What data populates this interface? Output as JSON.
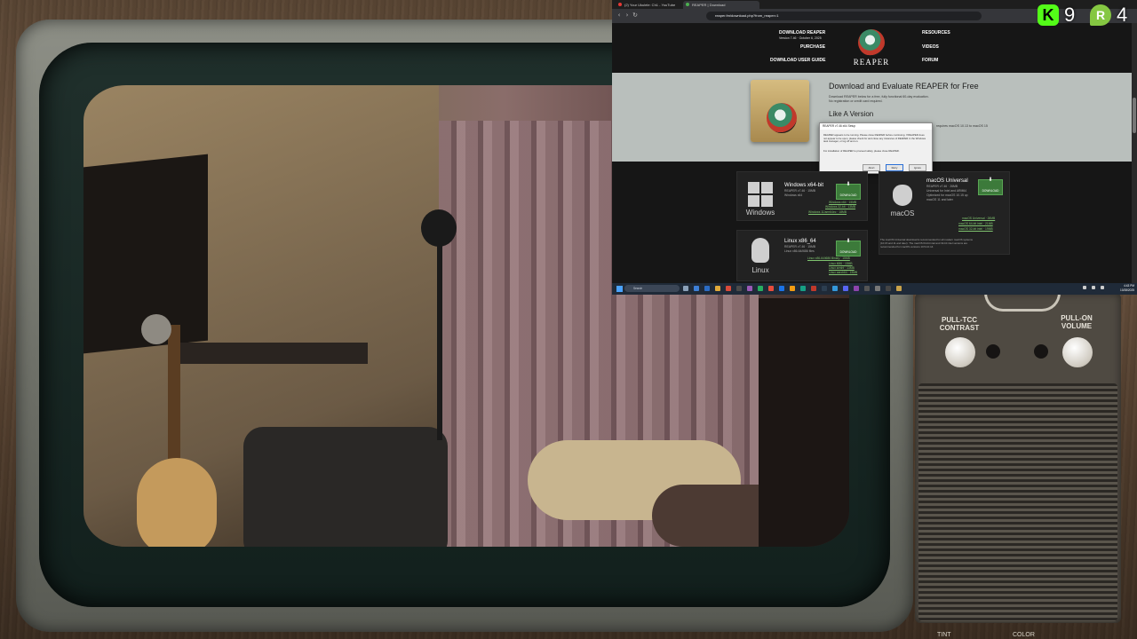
{
  "browser": {
    "tabs": [
      {
        "label": "(2) Your Ukulele: Ch1 - YouTube",
        "color": "#e53935"
      },
      {
        "label": "REAPER | Download",
        "color": "#4caf50"
      }
    ],
    "url": "reaper.fm/download.php?from_reaper=1"
  },
  "site": {
    "nav_left": {
      "download": "DOWNLOAD REAPER",
      "version": "Version 7.46 · October 6, 2025",
      "purchase": "PURCHASE",
      "user_guide": "DOWNLOAD USER GUIDE"
    },
    "logo_text": "REAPER",
    "nav_right": {
      "resources": "RESOURCES",
      "videos": "VIDEOS",
      "forum": "FORUM"
    },
    "hero": {
      "title": "Download and Evaluate REAPER for Free",
      "line1": "Download REAPER below for a free, fully functional 60-day evaluation.",
      "line2": "No registration or credit card required.",
      "subtitle": "Like A Version",
      "note": "requires macOS 10.13 to macOS 15"
    },
    "dialog": {
      "title": "REAPER v7.46 x64 Setup",
      "text1": "REAPER appears to be running. Please close REAPER before continuing. If REAPER does not appear to be open, please check for and close any instances of REAPER in the Windows task manager, or log off and on.",
      "text2": "For installation of REAPER to proceed safely, please close REAPER.",
      "btn_abort": "Abort",
      "btn_retry": "Retry",
      "btn_ignore": "Ignore"
    },
    "downloads": {
      "button_label": "DOWNLOAD",
      "windows": {
        "name": "Windows",
        "title": "Windows x64-bit",
        "meta1": "REAPER v7.46 · 15MB",
        "meta2": "Windows x64",
        "links": [
          "Windows x64 · 15MB",
          "Windows 32-bit · 13MB",
          "Windows 11/arm64ec · 18MB"
        ]
      },
      "mac": {
        "name": "macOS",
        "title": "macOS Universal",
        "meta1": "REAPER v7.46 · 26MB",
        "meta2": "Universal for Intel and ARM64",
        "meta3": "Optimized for macOS 10.15 up",
        "meta4": "macOS 11 and later",
        "links": [
          "macOS Universal · 26MB",
          "macOS 64-bit intel · 21MB",
          "macOS 32-bit intel · 19MB"
        ],
        "footnote1": "The macOS Universal download is recommended for all modern macOS systems",
        "footnote2": "(10.15 and 11 and later). The macOS 64-bit intel and 32-bit intel versions are",
        "footnote3": "recommended for macOS versions 10.5-10.14."
      },
      "linux": {
        "name": "Linux",
        "title": "Linux x86_64",
        "meta1": "REAPER v7.46 · 15MB",
        "meta2": "Linux x86-64/i686 files",
        "links": [
          "Linux x86-64/i686 Binary · 15MB",
          "Linux i686 · 15MB",
          "Linux armhf · 13MB",
          "Linux aarch64 · 15MB"
        ]
      }
    }
  },
  "taskbar": {
    "search": "Search",
    "time": "4:43 PM",
    "date": "10/28/2025"
  },
  "tv_panel": {
    "contrast_label": "PULL-TCC CONTRAST",
    "volume_label": "PULL-ON VOLUME",
    "tint_label": "TINT",
    "color_label": "COLOR"
  },
  "overlay": {
    "kick_count": "9",
    "rumble_count": "4",
    "kick_letter": "K",
    "rumble_letter": "R",
    "kick_color": "#53fc18",
    "rumble_color": "#85c742"
  }
}
